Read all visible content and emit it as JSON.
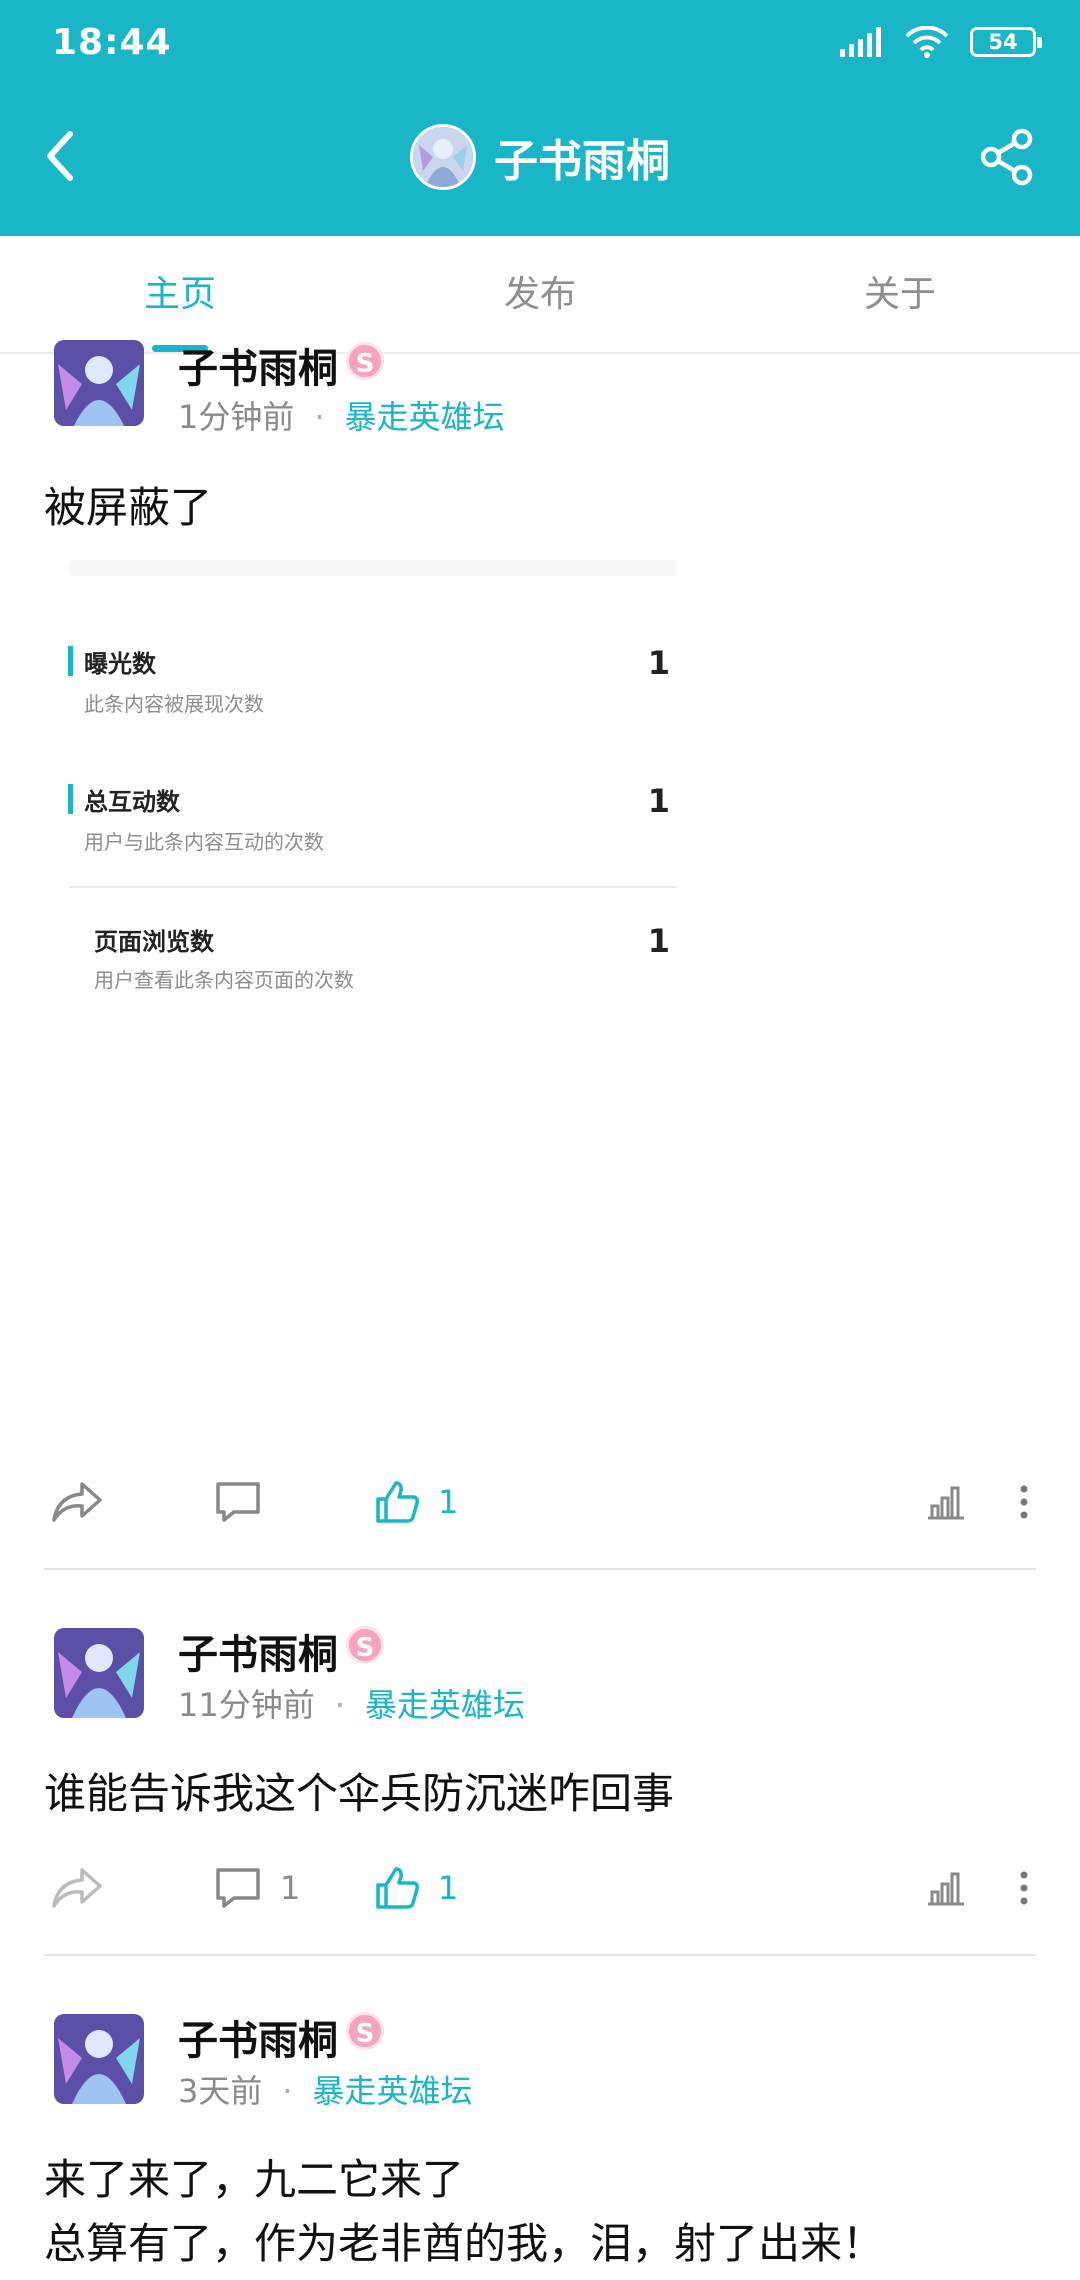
{
  "status_bar": {
    "time": "18:44",
    "battery": "54"
  },
  "header": {
    "title": "子书雨桐"
  },
  "tabs": [
    {
      "label": "主页",
      "active": true
    },
    {
      "label": "发布",
      "active": false
    },
    {
      "label": "关于",
      "active": false
    }
  ],
  "badge_text": "S",
  "posts": [
    {
      "author": "子书雨桐",
      "time": "1分钟前",
      "forum": "暴走英雄坛",
      "text": "被屏蔽了",
      "stats": [
        {
          "title": "曝光数",
          "subtitle": "此条内容被展现次数",
          "value": "1"
        },
        {
          "title": "总互动数",
          "subtitle": "用户与此条内容互动的次数",
          "value": "1"
        },
        {
          "title": "页面浏览数",
          "subtitle": "用户查看此条内容页面的次数",
          "value": "1"
        }
      ],
      "comments": "",
      "likes": "1"
    },
    {
      "author": "子书雨桐",
      "time": "11分钟前",
      "forum": "暴走英雄坛",
      "text": "谁能告诉我这个伞兵防沉迷咋回事",
      "comments": "1",
      "likes": "1"
    },
    {
      "author": "子书雨桐",
      "time": "3天前",
      "forum": "暴走英雄坛",
      "text_line1": "来了来了，九二它来了",
      "text_line2": "总算有了，作为老非酋的我，泪，射了出来！"
    }
  ],
  "colors": {
    "accent": "#18b6c6",
    "badge": "#f7a3bd"
  }
}
